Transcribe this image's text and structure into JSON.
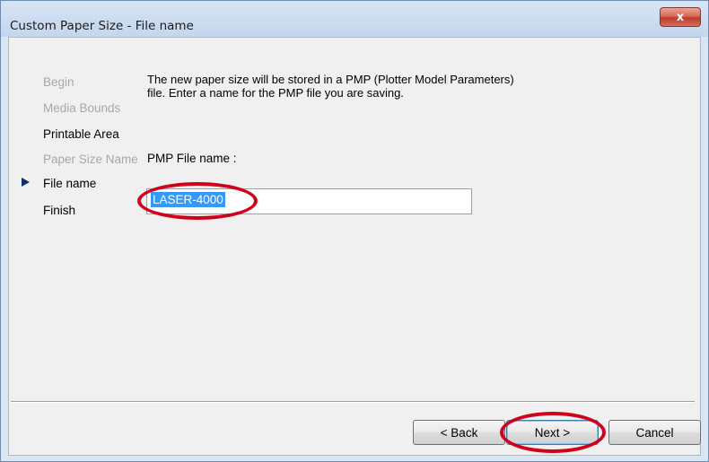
{
  "window": {
    "title": "Custom Paper Size - File name",
    "close_label": "x"
  },
  "steps": [
    {
      "label": "Begin",
      "state": "done"
    },
    {
      "label": "Media Bounds",
      "state": "done"
    },
    {
      "label": "Printable Area",
      "state": "active"
    },
    {
      "label": "Paper Size Name",
      "state": "done"
    },
    {
      "label": "File name",
      "state": "current"
    },
    {
      "label": "Finish",
      "state": "pending"
    }
  ],
  "main": {
    "description": "The new paper size will be stored in a PMP (Plotter Model Parameters) file. Enter a name for the PMP file you are saving.",
    "field_label": "PMP File name :",
    "file_name_value": "LASER-4000"
  },
  "buttons": {
    "back": "< Back",
    "next": "Next >",
    "cancel": "Cancel"
  },
  "colors": {
    "annotation": "#d0021b",
    "selection": "#3399ff",
    "step_arrow": "#0d2d6b"
  },
  "icons": {
    "current_step": "right-triangle-arrow",
    "close": "x-glyph"
  }
}
